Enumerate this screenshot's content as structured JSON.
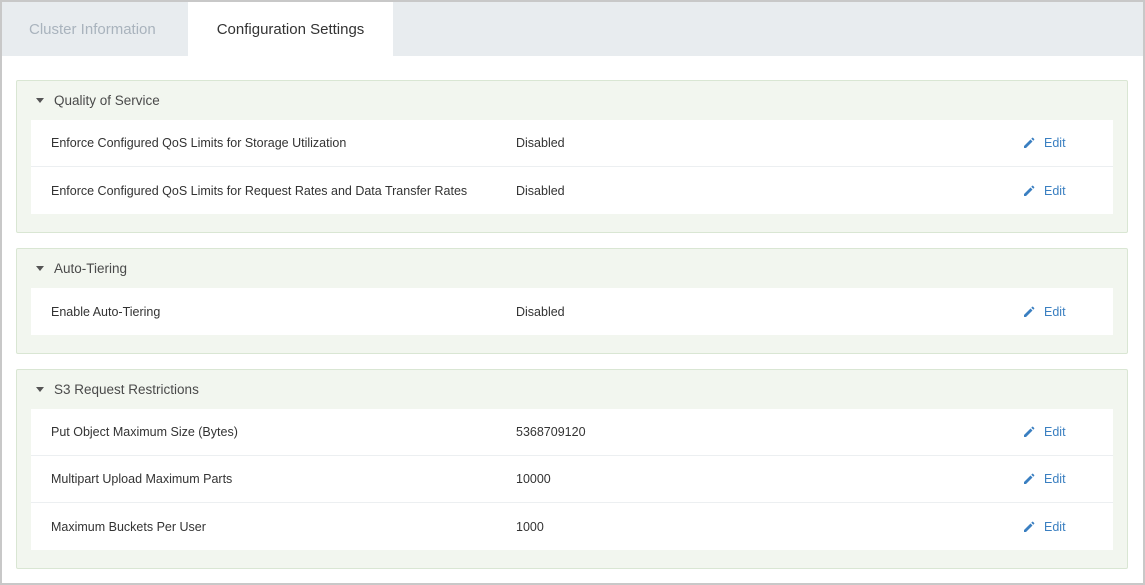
{
  "tabs": [
    {
      "label": "Cluster Information",
      "active": false
    },
    {
      "label": "Configuration Settings",
      "active": true
    }
  ],
  "colors": {
    "tab_bar_bg": "#e8ecef",
    "section_bg": "#f2f6ef",
    "edit_link": "#3a7fc1"
  },
  "sections": [
    {
      "title": "Quality of Service",
      "icon": "caret-down-icon",
      "rows": [
        {
          "label": "Enforce Configured QoS Limits for Storage Utilization",
          "value": "Disabled",
          "action": "Edit"
        },
        {
          "label": "Enforce Configured QoS Limits for Request Rates and Data Transfer Rates",
          "value": "Disabled",
          "action": "Edit"
        }
      ]
    },
    {
      "title": "Auto-Tiering",
      "icon": "caret-down-icon",
      "rows": [
        {
          "label": "Enable Auto-Tiering",
          "value": "Disabled",
          "action": "Edit"
        }
      ]
    },
    {
      "title": "S3 Request Restrictions",
      "icon": "caret-down-icon",
      "rows": [
        {
          "label": "Put Object Maximum Size (Bytes)",
          "value": "5368709120",
          "action": "Edit"
        },
        {
          "label": "Multipart Upload Maximum Parts",
          "value": "10000",
          "action": "Edit"
        },
        {
          "label": "Maximum Buckets Per User",
          "value": "1000",
          "action": "Edit"
        }
      ]
    }
  ]
}
